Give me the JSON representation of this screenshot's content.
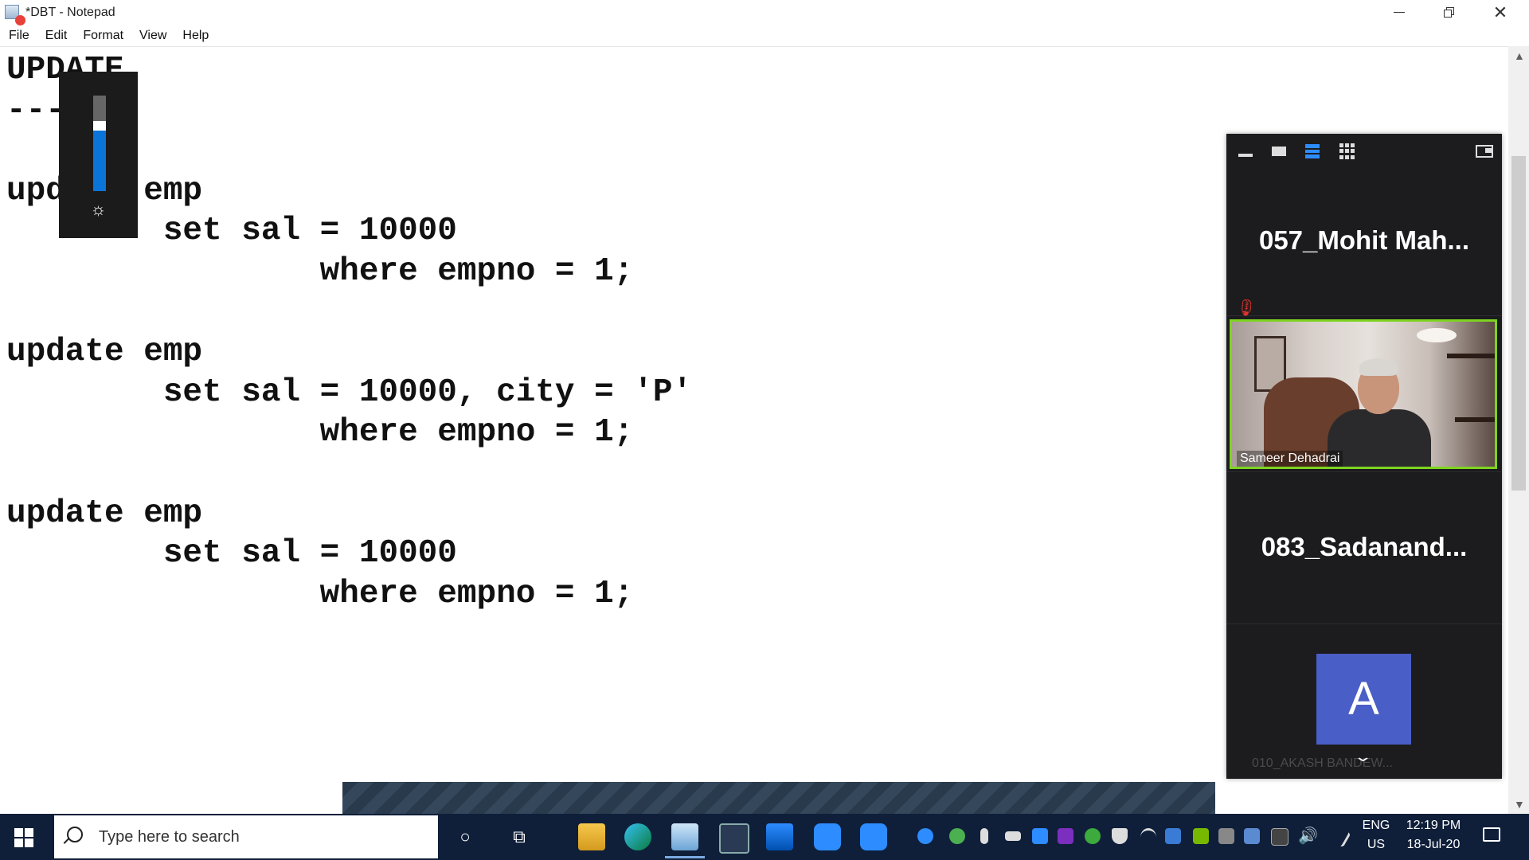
{
  "window": {
    "title": "*DBT - Notepad"
  },
  "menu": [
    "File",
    "Edit",
    "Format",
    "View",
    "Help"
  ],
  "editor": {
    "lines": [
      "UPDATE",
      "------",
      "",
      "update emp",
      "        set sal = 10000",
      "                where empno = 1;",
      "",
      "update emp",
      "        set sal = 10000, city = 'P'",
      "                where empno = 1;",
      "",
      "update emp",
      "        set sal = 10000",
      "                where empno = 1;"
    ]
  },
  "brightness_osd": {
    "level_percent": 73,
    "icon": "sun-icon"
  },
  "zoom_panel": {
    "toolbar_icons": [
      "minimize-icon",
      "speaker-view-icon",
      "strip-view-icon",
      "gallery-view-icon",
      "popout-icon"
    ],
    "participants": [
      {
        "name": "057_Mohit  Mah...",
        "video": false
      },
      {
        "name": "Sameer Dehadrai",
        "video": true,
        "muted": true,
        "active_speaker": true
      },
      {
        "name": "083_Sadanand...",
        "video": false
      },
      {
        "name": "010_AKASH BANDEW...",
        "avatar_letter": "A",
        "video": false
      }
    ],
    "accent": "#2d8cff",
    "speaker_border": "#7ed321",
    "avatar_color": "#4a5ec8"
  },
  "taskbar": {
    "search_placeholder": "Type here to search",
    "language": "ENG",
    "region": "US",
    "time": "12:19 PM",
    "date": "18-Jul-20"
  }
}
